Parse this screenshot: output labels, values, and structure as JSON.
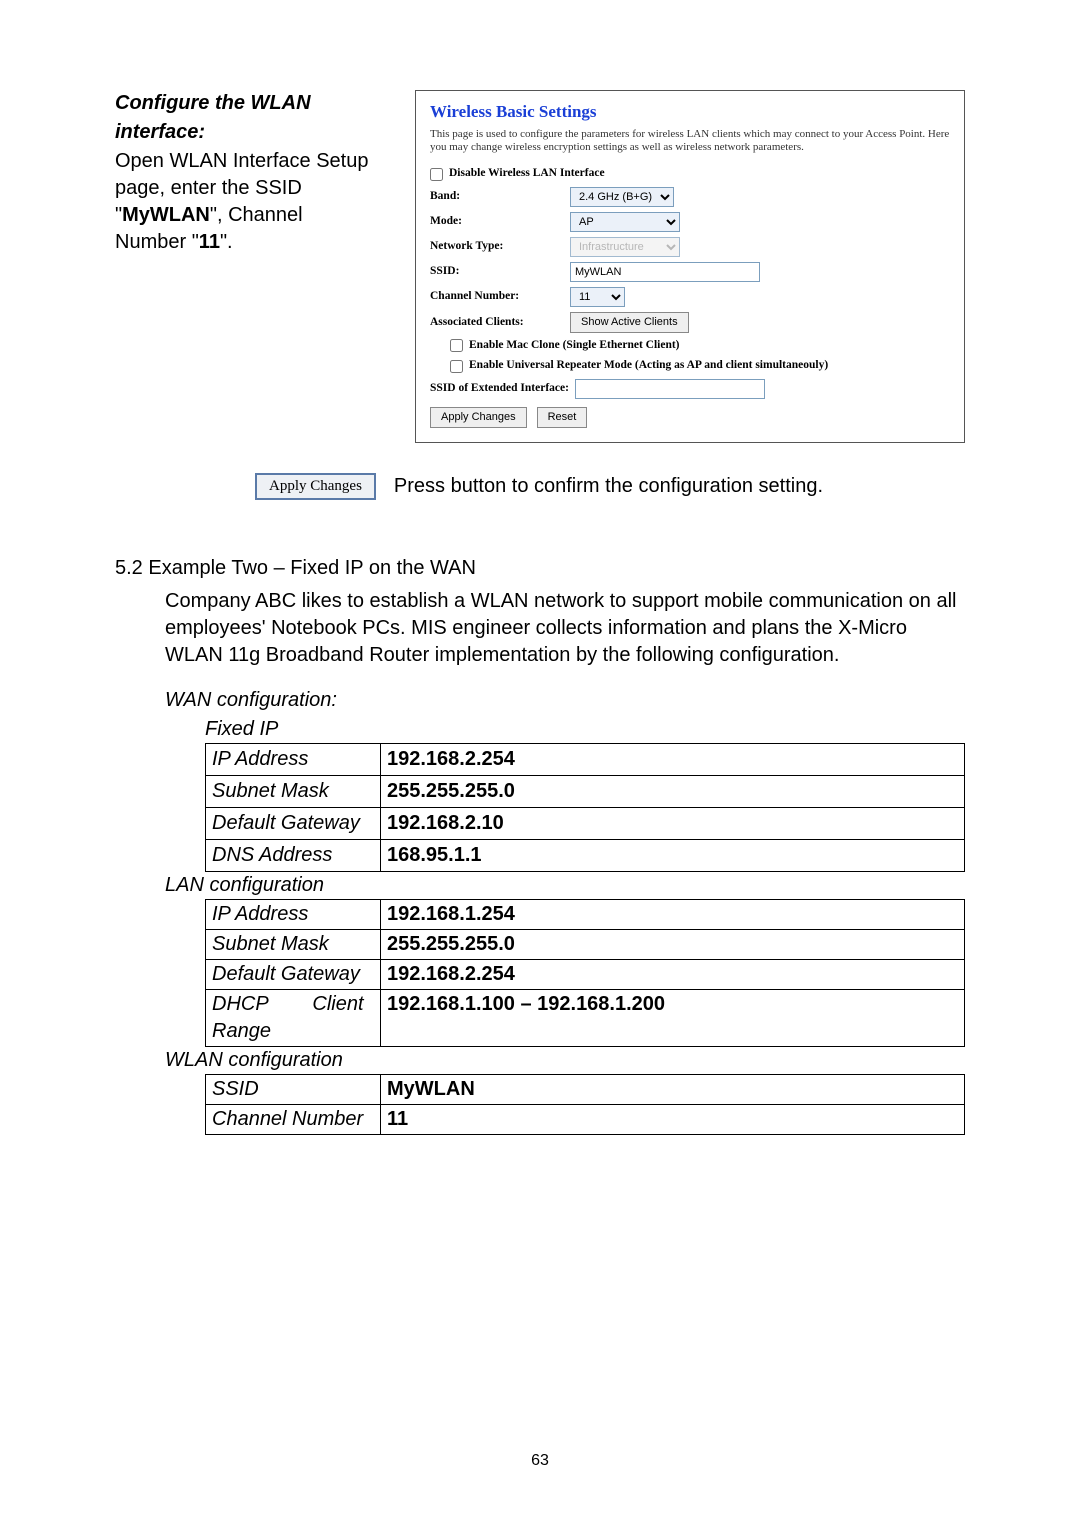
{
  "left": {
    "heading1": "Configure the WLAN",
    "heading2": "interface:",
    "body_pre": "Open WLAN Interface Setup page, enter the SSID \"",
    "ssid": "MyWLAN",
    "body_mid": "\", Channel Number \"",
    "chan": "11",
    "body_end": "\"."
  },
  "panel": {
    "title": "Wireless Basic Settings",
    "desc": "This page is used to configure the parameters for wireless LAN clients which may connect to your Access Point. Here you may change wireless encryption settings as well as wireless network parameters.",
    "disable_label": "Disable Wireless LAN Interface",
    "band_label": "Band:",
    "band_value": "2.4 GHz (B+G)",
    "mode_label": "Mode:",
    "mode_value": "AP",
    "network_type_label": "Network Type:",
    "network_type_value": "Infrastructure",
    "ssid_label": "SSID:",
    "ssid_value": "MyWLAN",
    "channel_label": "Channel Number:",
    "channel_value": "11",
    "assoc_label": "Associated Clients:",
    "assoc_btn": "Show Active Clients",
    "mac_clone_label": "Enable Mac Clone (Single Ethernet Client)",
    "repeater_label": "Enable Universal Repeater Mode (Acting as AP and client simultaneouly)",
    "ext_ssid_label": "SSID of Extended Interface:",
    "ext_ssid_value": "",
    "apply_btn": "Apply Changes",
    "reset_btn": "Reset"
  },
  "apply": {
    "btn": "Apply Changes",
    "caption": "Press button to confirm the configuration setting."
  },
  "section52": {
    "title": "5.2 Example Two – Fixed IP on the WAN",
    "para": "Company ABC likes to establish a WLAN network to support mobile communication on all employees' Notebook PCs. MIS engineer collects information and plans the X-Micro WLAN 11g Broadband Router implementation by the following configuration."
  },
  "wan": {
    "heading": "WAN configuration:",
    "sub": "Fixed IP",
    "ip_label": "IP Address",
    "ip": "192.168.2.254",
    "mask_label": "Subnet Mask",
    "mask": "255.255.255.0",
    "gw_label": "Default Gateway",
    "gw": "192.168.2.10",
    "dns_label": "DNS Address",
    "dns": "168.95.1.1"
  },
  "lan": {
    "heading": "LAN configuration",
    "ip_label": "IP Address",
    "ip": "192.168.1.254",
    "mask_label": "Subnet Mask",
    "mask": "255.255.255.0",
    "gw_label": "Default Gateway",
    "gw": "192.168.2.254",
    "dhcp_label_1": "DHCP",
    "dhcp_label_2": "Client",
    "dhcp_label_3": "Range",
    "dhcp": "192.168.1.100 – 192.168.1.200"
  },
  "wlan": {
    "heading": "WLAN configuration",
    "ssid_label": "SSID",
    "ssid": "MyWLAN",
    "chan_label": "Channel Number",
    "chan": "11"
  },
  "page_num": "63"
}
